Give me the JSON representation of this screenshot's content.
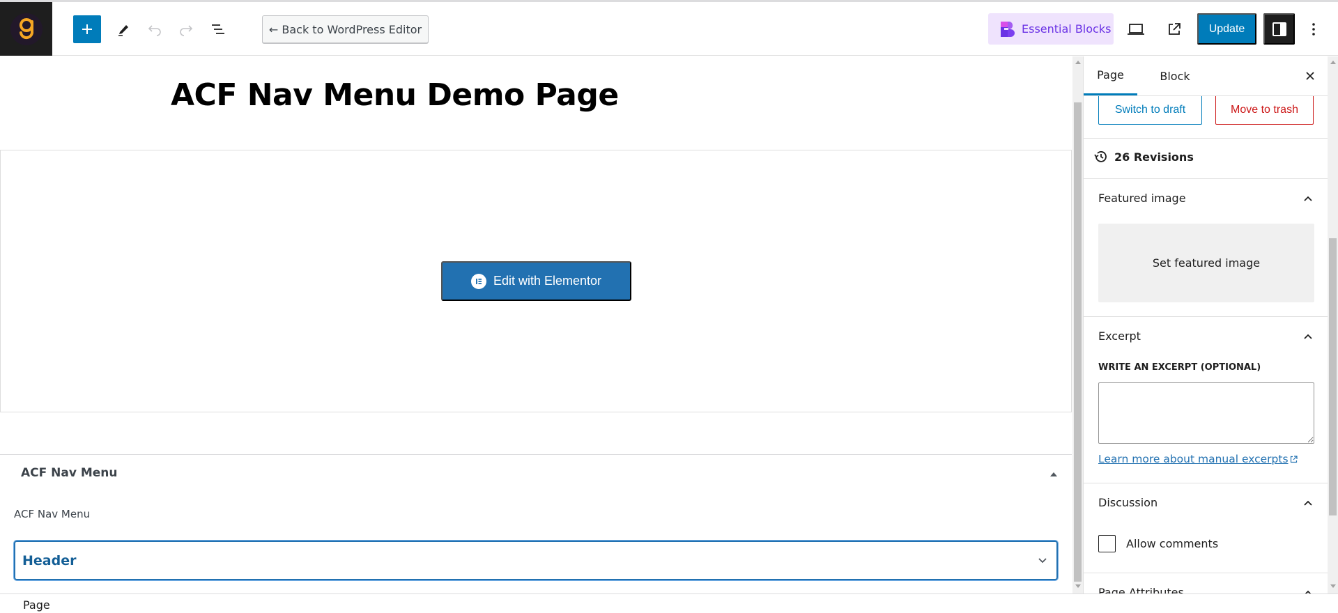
{
  "toolbar": {
    "logo_letter": "g",
    "add_block_label": "Add block",
    "back_button": "← Back to WordPress Editor",
    "essential_blocks": "Essential Blocks",
    "update_button": "Update",
    "icons": {
      "add": "plus-icon",
      "tools": "pencil-icon",
      "undo": "undo-icon",
      "redo": "redo-icon",
      "list_view": "list-view-icon",
      "preview": "laptop-icon",
      "view_page": "external-link-icon",
      "settings": "sidebar-toggle-icon",
      "options": "kebab-icon"
    },
    "colors": {
      "accent": "#007cba",
      "essential_blocks_bg": "#efe3fd",
      "essential_blocks_text": "#6a32e5",
      "logo": "#f5a623"
    }
  },
  "editor": {
    "page_title": "ACF Nav Menu Demo Page",
    "elementor_button": "Edit with Elementor",
    "metabox": {
      "title": "ACF Nav Menu",
      "field_label": "ACF Nav Menu",
      "select_value": "Header"
    }
  },
  "sidebar": {
    "tabs": [
      {
        "label": "Page",
        "active": true
      },
      {
        "label": "Block",
        "active": false
      }
    ],
    "switch_to_draft": "Switch to draft",
    "move_to_trash": "Move to trash",
    "revisions": "26 Revisions",
    "featured_image": {
      "title": "Featured image",
      "placeholder": "Set featured image"
    },
    "excerpt": {
      "title": "Excerpt",
      "label": "WRITE AN EXCERPT (OPTIONAL)",
      "value": "",
      "link": "Learn more about manual excerpts"
    },
    "discussion": {
      "title": "Discussion",
      "allow_comments_label": "Allow comments",
      "allow_comments_checked": false
    },
    "page_attributes": {
      "title": "Page Attributes"
    }
  },
  "footer": {
    "breadcrumb": "Page"
  }
}
